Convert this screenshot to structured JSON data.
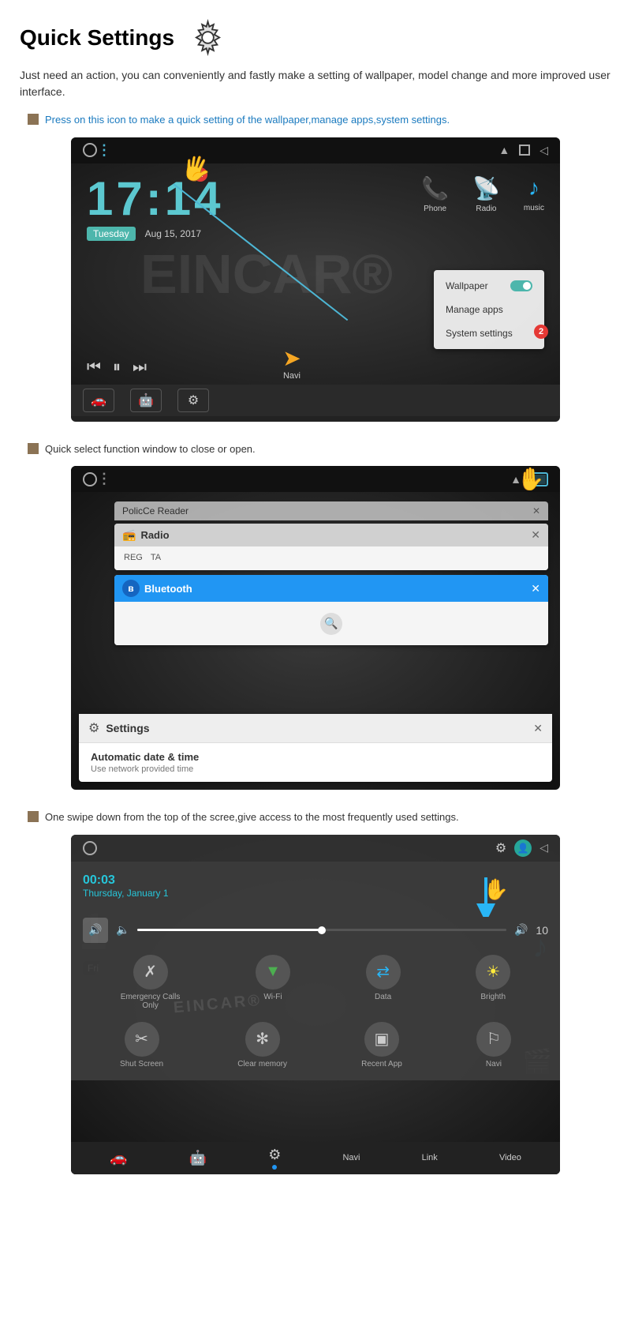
{
  "page": {
    "title": "Quick Settings",
    "description": "Just need an action, you can conveniently and fastly make a setting of wallpaper, model change and more improved user interface."
  },
  "section1": {
    "bullet_text": "Press on this icon to make a quick setting of the wallpaper,manage apps,system settings.",
    "time": "17:14",
    "day": "Tuesday",
    "date": "Aug 15, 2017",
    "phone_label": "Phone",
    "radio_label": "Radio",
    "music_label": "music",
    "navi_label": "Navi",
    "menu_items": [
      "Wallpaper",
      "Manage apps",
      "System settings"
    ],
    "badge1": "1",
    "badge2": "2"
  },
  "section2": {
    "bullet_text": "Quick select function window to close or open.",
    "windows": [
      {
        "title": "Radio",
        "content": "REG  TA"
      },
      {
        "title": "Bluetooth"
      },
      {
        "title": "Settings",
        "subtitle": "Automatic date & time",
        "desc": "Use network provided time"
      }
    ]
  },
  "section3": {
    "bullet_text": "One swipe down from the top of the scree,give access to the most frequently used settings.",
    "time": "00:03",
    "date": "Thursday, January 1",
    "volume_level": "10",
    "quick_icons": [
      {
        "label": "Emergency Calls\nOnly",
        "icon": "✗"
      },
      {
        "label": "Wi-Fi",
        "icon": "▼"
      },
      {
        "label": "Data",
        "icon": "⇄"
      },
      {
        "label": "Brighth",
        "icon": "☀"
      }
    ],
    "quick_icons2": [
      {
        "label": "Shut Screen",
        "icon": "✂"
      },
      {
        "label": "Clear memory",
        "icon": "✻"
      },
      {
        "label": "Recent App",
        "icon": "▣"
      },
      {
        "label": "Navi",
        "icon": "⚐"
      }
    ],
    "bottom_tabs": [
      "Navi",
      "Link",
      "Video"
    ]
  },
  "icons": {
    "gear": "⚙",
    "close": "✕",
    "bluetooth_symbol": "ʙ",
    "settings_cog": "⚙"
  }
}
